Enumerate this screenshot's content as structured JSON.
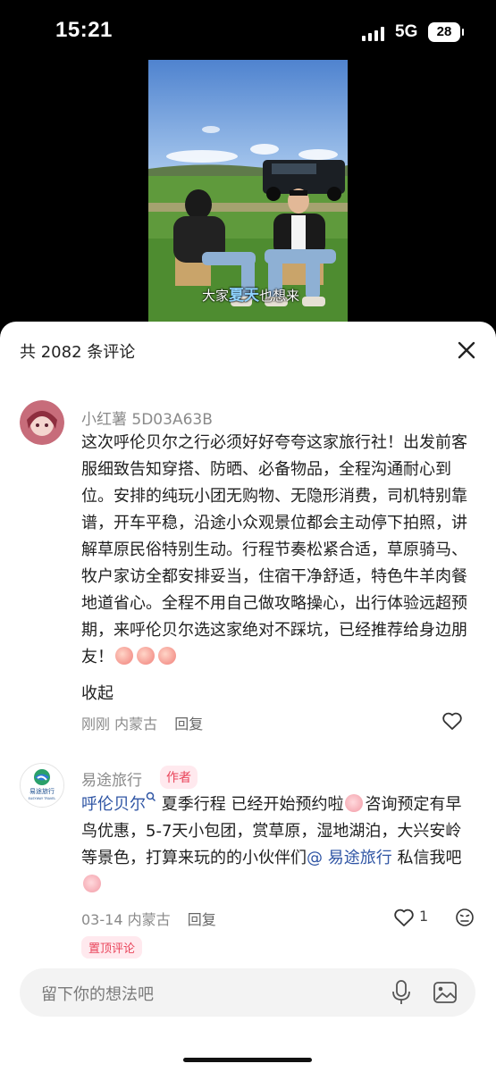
{
  "status_bar": {
    "time": "15:21",
    "network": "5G",
    "battery": "28"
  },
  "video": {
    "caption_prefix": "大家",
    "caption_highlight": "夏天",
    "caption_suffix": "也想来"
  },
  "comments_panel": {
    "title": "共 2082 条评论",
    "comments": [
      {
        "user": "小红薯 5D03A63B",
        "text": "这次呼伦贝尔之行必须好好夸夸这家旅行社！出发前客服细致告知穿搭、防晒、必备物品，全程沟通耐心到位。安排的纯玩小团无购物、无隐形消费，司机特别靠谱，开车平稳，沿途小众观景位都会主动停下拍照，讲解草原民俗特别生动。行程节奏松紧合适，草原骑马、牧户家访全都安排妥当，住宿干净舒适，特色牛羊肉餐地道省心。全程不用自己做攻略操心，出行体验远超预期，来呼伦贝尔选这家绝对不踩坑，已经推荐给身边朋友！",
        "collapse": "收起",
        "time": "刚刚",
        "location": "内蒙古",
        "reply": "回复"
      },
      {
        "user": "易途旅行",
        "author_tag": "作者",
        "avatar_text": "易途旅行",
        "avatar_subtext": "EASYWAY TRAVEL",
        "link": "呼伦贝尔",
        "text_a": " 夏季行程  已经开始预约啦",
        "text_b": "咨询预定有早鸟优惠，5-7天小包团，赏草原，湿地湖泊，大兴安岭等景色，打算来玩的的小伙伴们",
        "mention": "@ 易途旅行",
        "text_c": " 私信我吧",
        "time": "03-14",
        "location": "内蒙古",
        "reply": "回复",
        "likes": "1",
        "pin_tag": "置顶评论"
      }
    ],
    "input_placeholder": "留下你的想法吧"
  },
  "colors": {
    "author_tag_bg": "#ffe9ee",
    "author_tag_text": "#e9445a",
    "link": "#2f55a4"
  },
  "icons": [
    "close-icon",
    "heart-icon",
    "dislike-face-icon",
    "search-icon",
    "mic-icon",
    "image-icon",
    "peach-emoji-icon",
    "pig-emoji-icon"
  ]
}
